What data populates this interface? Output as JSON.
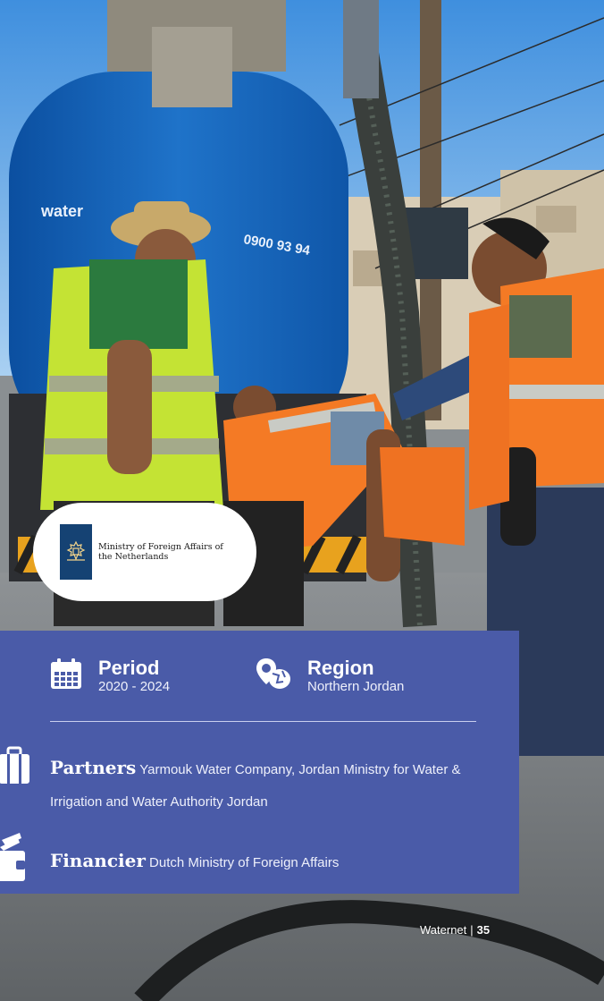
{
  "logo": {
    "text": "Ministry of Foreign Affairs of the Netherlands",
    "crest_icon": "royal-coat-of-arms-icon",
    "crest_color": "#154273"
  },
  "truck": {
    "brand": "water",
    "phone": "0900 93 94"
  },
  "info": {
    "panel_color": "#4a5ba8",
    "period": {
      "label": "Period",
      "value": "2020 - 2024",
      "icon": "calendar-icon"
    },
    "region": {
      "label": "Region",
      "value": "Northern Jordan",
      "icon": "map-pin-icon"
    },
    "partners": {
      "label": "Partners",
      "value": "Yarmouk Water Company, Jordan Ministry for Water & Irrigation and Water Authority Jordan",
      "icon": "briefcase-icon"
    },
    "financier": {
      "label": "Financier",
      "value": "Dutch Ministry of Foreign Affairs",
      "icon": "wallet-icon"
    }
  },
  "footer": {
    "publisher": "Waternet",
    "page_number": "35"
  }
}
